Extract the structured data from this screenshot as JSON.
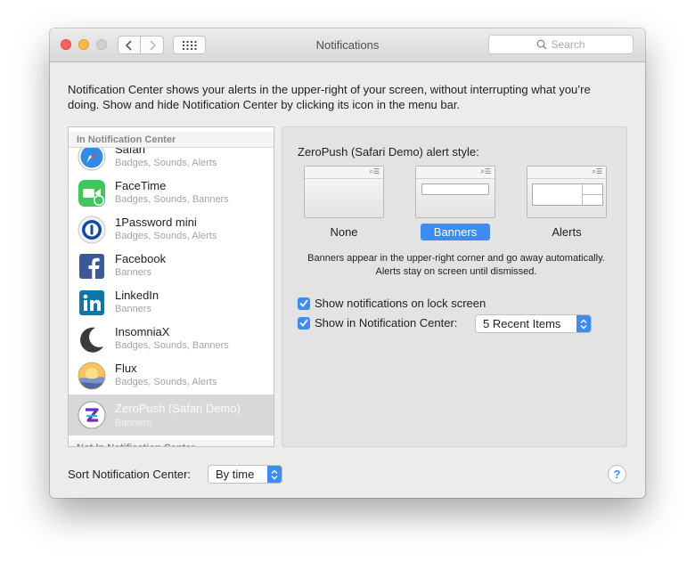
{
  "window": {
    "title": "Notifications",
    "search_placeholder": "Search"
  },
  "intro": "Notification Center shows your alerts in the upper-right of your screen, without interrupting what you’re doing. Show and hide Notification Center by clicking its icon in the menu bar.",
  "list": {
    "header_in": "In Notification Center",
    "header_out": "Not In Notification Center",
    "apps": [
      {
        "name": "Safari",
        "sub": "Badges, Sounds, Alerts",
        "icon": "safari-icon"
      },
      {
        "name": "FaceTime",
        "sub": "Badges, Sounds, Banners",
        "icon": "facetime-icon"
      },
      {
        "name": "1Password mini",
        "sub": "Badges, Sounds, Alerts",
        "icon": "1password-icon"
      },
      {
        "name": "Facebook",
        "sub": "Banners",
        "icon": "facebook-icon"
      },
      {
        "name": "LinkedIn",
        "sub": "Banners",
        "icon": "linkedin-icon"
      },
      {
        "name": "InsomniaX",
        "sub": "Badges, Sounds, Banners",
        "icon": "insomniax-icon"
      },
      {
        "name": "Flux",
        "sub": "Badges, Sounds, Alerts",
        "icon": "flux-icon"
      },
      {
        "name": "ZeroPush (Safari Demo)",
        "sub": "Banners",
        "icon": "zeropush-icon"
      }
    ]
  },
  "panel": {
    "alert_style_label": "ZeroPush (Safari Demo) alert style:",
    "styles": [
      "None",
      "Banners",
      "Alerts"
    ],
    "selected_style": "Banners",
    "description": "Banners appear in the upper-right corner and go away automatically. Alerts stay on screen until dismissed.",
    "lock_screen_label": "Show notifications on lock screen",
    "nc_label": "Show in Notification Center:",
    "nc_value": "5 Recent Items"
  },
  "sort": {
    "label": "Sort Notification Center:",
    "value": "By time"
  },
  "help": "?",
  "colors": {
    "accent": "#3b8cf3",
    "selection": "#d8d8d8"
  }
}
